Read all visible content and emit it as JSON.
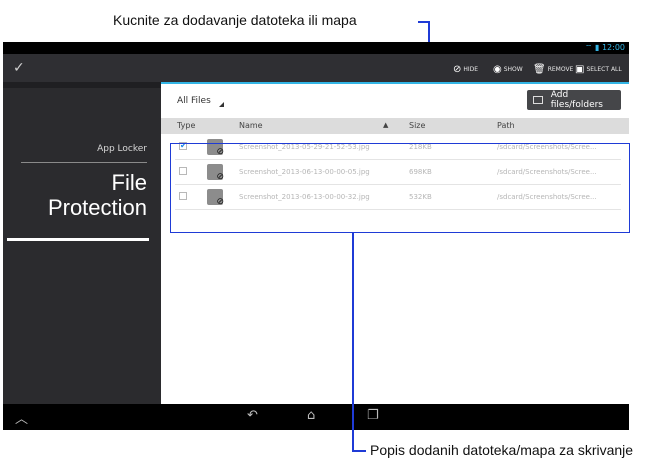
{
  "annotations": {
    "top": "Kucnite za dodavanje datoteka ili mapa",
    "bottom": "Popis dodanih datoteka/mapa za skrivanje"
  },
  "status": {
    "time": "12:00"
  },
  "actionbar": {
    "hide": "HIDE",
    "show": "SHOW",
    "remove": "REMOVE",
    "select_all": "SELECT ALL"
  },
  "sidebar": {
    "app_locker": "App Locker",
    "file_protection": "File Protection"
  },
  "content": {
    "filter": "All Files",
    "add_button": "Add files/folders",
    "columns": {
      "type": "Type",
      "name": "Name",
      "size": "Size",
      "path": "Path"
    },
    "rows": [
      {
        "checked": true,
        "name": "Screenshot_2013-05-29-21-52-53.jpg",
        "size": "218KB",
        "path": "/sdcard/Screenshots/Scree..."
      },
      {
        "checked": false,
        "name": "Screenshot_2013-06-13-00-00-05.jpg",
        "size": "698KB",
        "path": "/sdcard/Screenshots/Scree..."
      },
      {
        "checked": false,
        "name": "Screenshot_2013-06-13-00-00-32.jpg",
        "size": "532KB",
        "path": "/sdcard/Screenshots/Scree..."
      }
    ]
  },
  "colors": {
    "accent": "#33b5e5",
    "callout": "#1f3bd6"
  }
}
